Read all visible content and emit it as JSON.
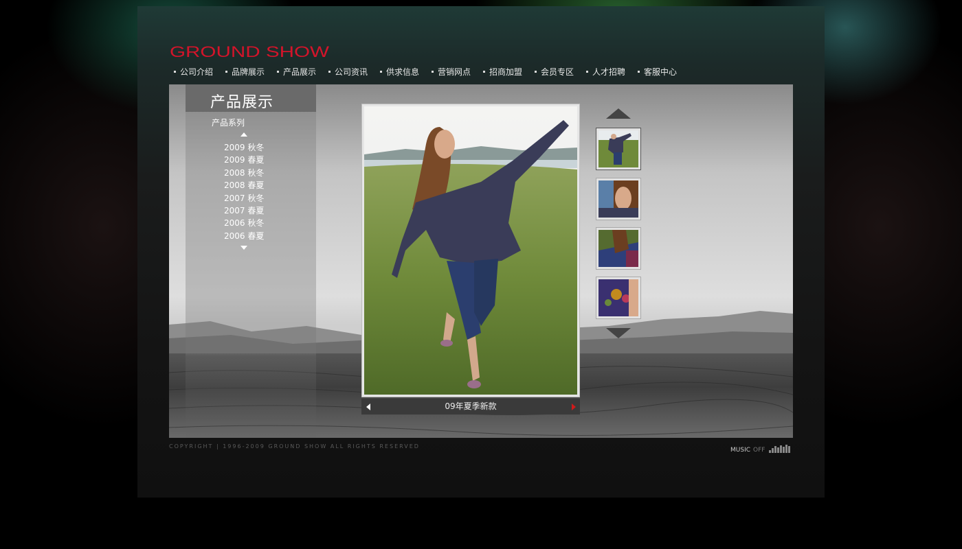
{
  "brand": {
    "logo_text": "GROUND SHOW",
    "logo_color": "#d4142a"
  },
  "nav": {
    "items": [
      "公司介绍",
      "品牌展示",
      "产品展示",
      "公司资讯",
      "供求信息",
      "营销网点",
      "招商加盟",
      "会员专区",
      "人才招聘",
      "客服中心"
    ]
  },
  "products": {
    "section_title": "产品展示",
    "series_title": "产品系列",
    "series": [
      "2009 秋冬",
      "2009 春夏",
      "2008 秋冬",
      "2008 春夏",
      "2007 秋冬",
      "2007 春夏",
      "2006 秋冬",
      "2006 春夏"
    ]
  },
  "viewer": {
    "caption": "09年夏季新款"
  },
  "footer": {
    "copyright": "COPYRIGHT | 1996-2009 GROUND SHOW  ALL RIGHTS RESERVED",
    "music_label": "MUSIC",
    "music_state": "OFF"
  }
}
